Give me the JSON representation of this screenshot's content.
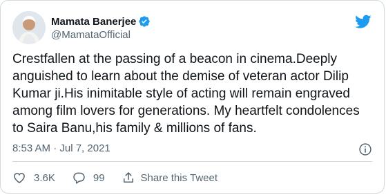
{
  "tweet": {
    "author": {
      "display_name": "Mamata Banerjee",
      "handle": "@MamataOfficial",
      "verified": true,
      "avatar_icon": "avatar-photo"
    },
    "text": "Crestfallen at the passing of a beacon in cinema.Deeply anguished to learn about the demise of veteran actor Dilip Kumar ji.His inimitable style of acting will remain engraved among film lovers for generations. My heartfelt condolences to Saira Banu,his family & millions of fans.",
    "timestamp": "8:53 AM · Jul 7, 2021",
    "actions": {
      "likes": "3.6K",
      "replies": "99",
      "share_label": "Share this Tweet"
    }
  },
  "colors": {
    "brand": "#1d9bf0",
    "text_primary": "#0f1419",
    "text_secondary": "#536471",
    "border": "#cfd9de"
  },
  "icons": [
    "twitter-bird-icon",
    "verified-badge-icon",
    "info-icon",
    "heart-icon",
    "reply-icon",
    "share-icon"
  ]
}
